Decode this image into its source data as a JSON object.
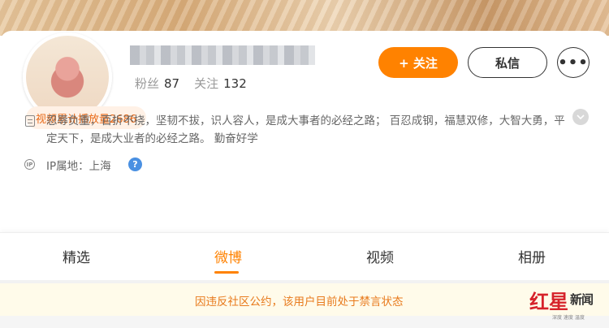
{
  "profile": {
    "stats": {
      "fans_label": "粉丝",
      "fans_count": "87",
      "following_label": "关注",
      "following_count": "132"
    },
    "follow_button_icon": "plus-icon",
    "follow_button_label": "+ 关注",
    "message_button_label": "私信",
    "more_button_icon": "ellipsis-icon",
    "badge_text": "视频累计播放量2686",
    "bio": "忍辱负重，百折不挠，坚韧不拔，识人容人，是成大事者的必经之路； 百忍成钢，福慧双修，大智大勇，平定天下，是成大业者的必经之路。 勤奋好学",
    "ip_location": "IP属地：上海"
  },
  "tabs": [
    {
      "label": "精选",
      "active": false
    },
    {
      "label": "微博",
      "active": true
    },
    {
      "label": "视频",
      "active": false
    },
    {
      "label": "相册",
      "active": false
    }
  ],
  "notice": {
    "text": "因违反社区公约，该用户目前处于禁言状态"
  },
  "watermark": {
    "brand_char_1": "红",
    "brand_char_2": "星",
    "brand_char_3": "新闻",
    "subtitle": "深度 速度 温度"
  },
  "colors": {
    "accent": "#ff8200",
    "notice_text": "#e87a1c",
    "help_icon": "#4a90e2",
    "watermark_red": "#d6222a"
  }
}
